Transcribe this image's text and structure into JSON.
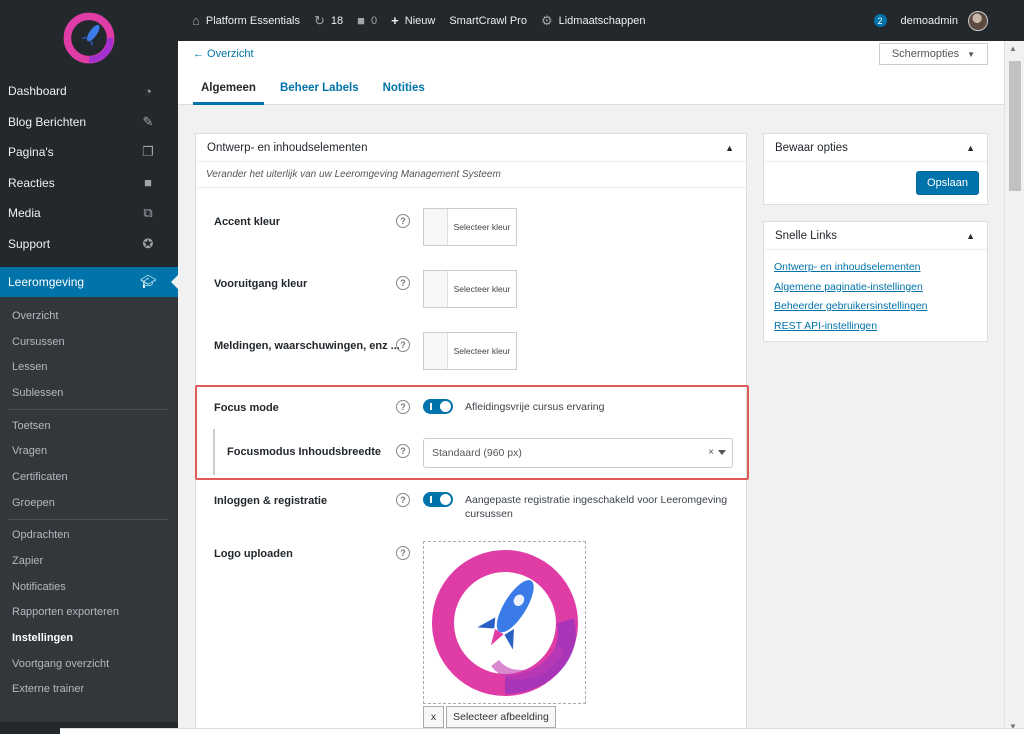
{
  "colors": {
    "accent": "#0073aa",
    "sidebar_bg": "#23282d",
    "highlight": "#e05a5a",
    "logo_pink": "#e03ca5",
    "rocket_blue": "#3b7be8"
  },
  "sidebar": {
    "menu": [
      {
        "label": "Dashboard",
        "icon": "dashboard-icon"
      },
      {
        "label": "Blog Berichten",
        "icon": "pin-icon"
      },
      {
        "label": "Pagina's",
        "icon": "pages-icon"
      },
      {
        "label": "Reacties",
        "icon": "comments-icon"
      },
      {
        "label": "Media",
        "icon": "media-icon"
      },
      {
        "label": "Support",
        "icon": "lifebuoy-icon"
      }
    ],
    "active": {
      "label": "Leeromgeving",
      "icon": "graduation-cap-icon"
    },
    "submenu": [
      "Overzicht",
      "Cursussen",
      "Lessen",
      "Sublessen",
      "Toetsen",
      "Vragen",
      "Certificaten",
      "Groepen",
      "Opdrachten",
      "Zapier",
      "Notificaties",
      "Rapporten exporteren",
      "Instellingen",
      "Voortgang overzicht",
      "Externe trainer"
    ]
  },
  "adminbar": {
    "site": "Platform Essentials",
    "updates": "18",
    "comments": "0",
    "new": "Nieuw",
    "plugin": "SmartCrawl Pro",
    "memberships": "Lidmaatschappen",
    "notifications": "2",
    "user": "demoadmin"
  },
  "topbar": {
    "back": "← Overzicht",
    "screen_options": "Schermopties",
    "tabs": [
      "Algemeen",
      "Beheer Labels",
      "Notities"
    ]
  },
  "main": {
    "title": "Ontwerp- en inhoudselementen",
    "description": "Verander het uiterlijk van uw Leeromgeving Management Systeem",
    "accent_label": "Accent kleur",
    "progress_label": "Vooruitgang kleur",
    "notices_label": "Meldingen, waarschuwingen, enz ...",
    "select_color": "Selecteer kleur",
    "focus_label": "Focus mode",
    "focus_text": "Afleidingsvrije cursus ervaring",
    "width_label": "Focusmodus Inhoudsbreedte",
    "width_value": "Standaard (960 px)",
    "login_label": "Inloggen & registratie",
    "login_text": "Aangepaste registratie ingeschakeld voor Leeromgeving cursussen",
    "logo_label": "Logo uploaden",
    "remove_btn": "x",
    "select_image": "Selecteer afbeelding",
    "help": "?"
  },
  "save_box": {
    "title": "Bewaar opties",
    "button": "Opslaan"
  },
  "links_box": {
    "title": "Snelle Links",
    "links": [
      "Ontwerp- en inhoudselementen",
      "Algemene paginatie-instellingen",
      "Beheerder gebruikersinstellingen",
      "REST API-instellingen"
    ]
  }
}
